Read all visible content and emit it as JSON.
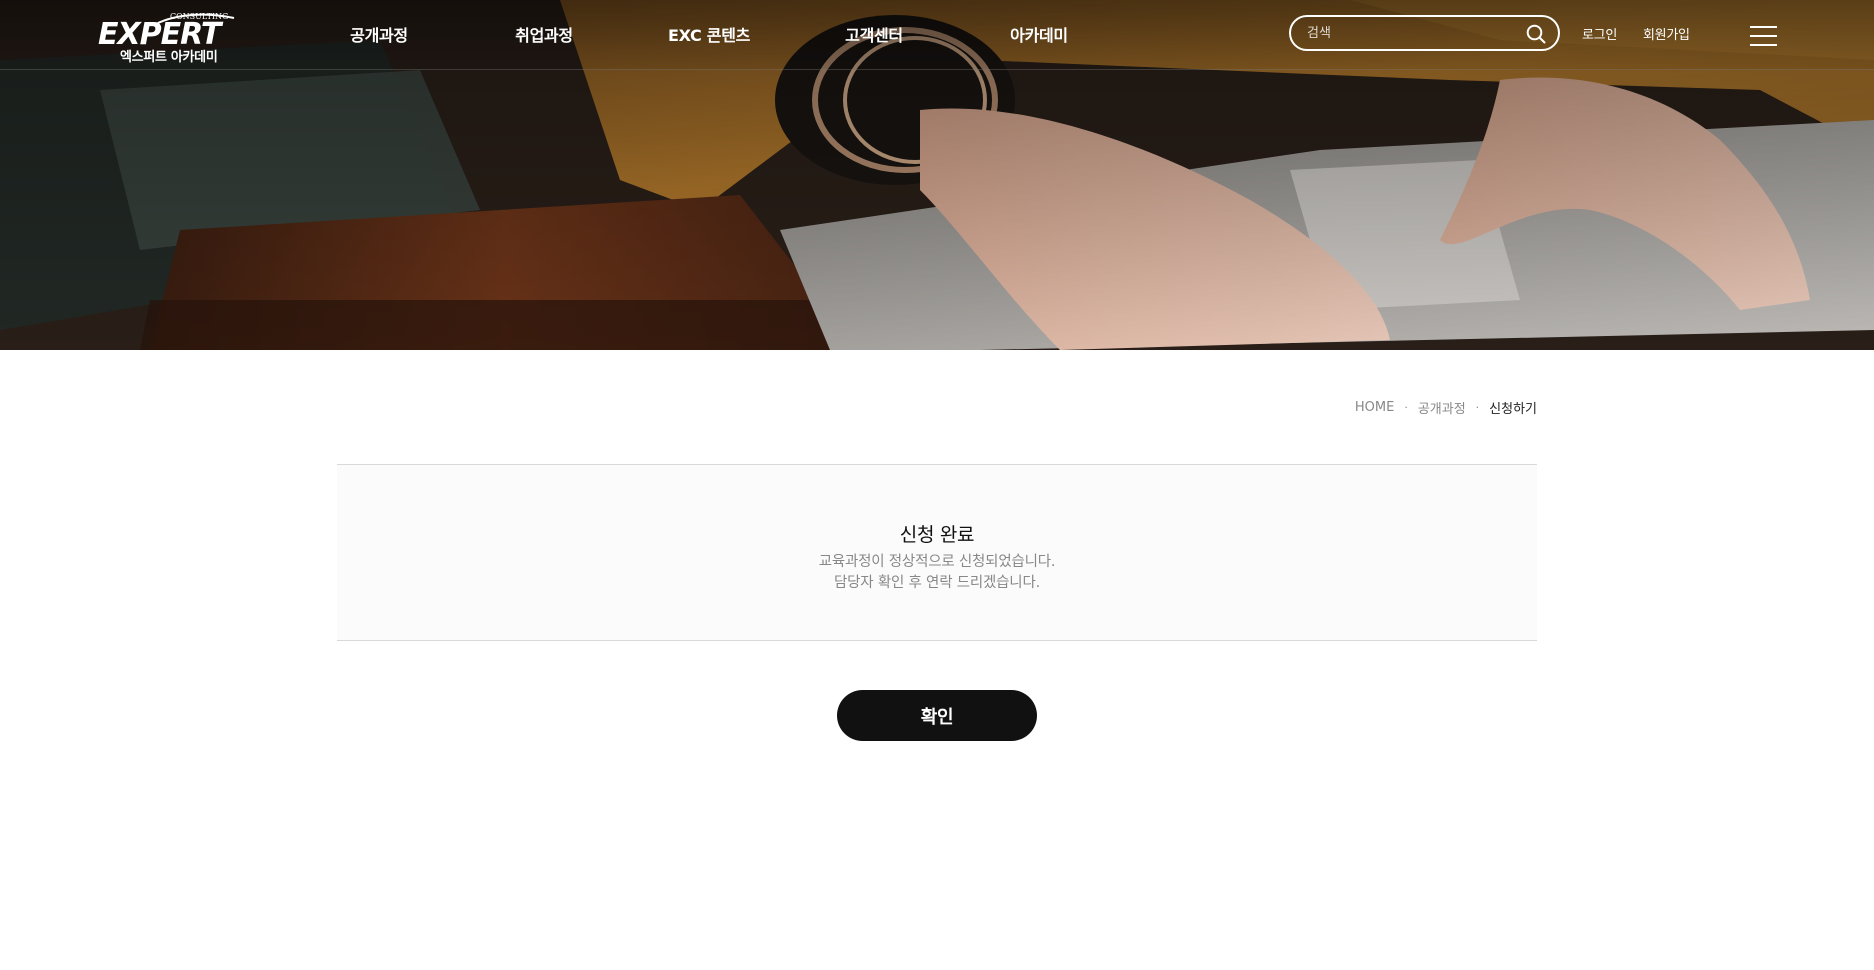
{
  "header": {
    "logo": {
      "wordmark": "EXPERT",
      "tagline": "CONSULTING",
      "subtitle": "엑스퍼트 아카데미"
    },
    "nav": [
      {
        "label": "공개과정"
      },
      {
        "label": "취업과정"
      },
      {
        "label": "EXC 콘텐츠"
      },
      {
        "label": "고객센터"
      },
      {
        "label": "아카데미"
      }
    ],
    "search": {
      "placeholder": "검색",
      "icon": "search-icon"
    },
    "login_label": "로그인",
    "signup_label": "회원가입",
    "menu_icon": "hamburger-menu-icon"
  },
  "breadcrumb": {
    "items": [
      "HOME",
      "공개과정",
      "신청하기"
    ]
  },
  "result": {
    "title": "신청 완료",
    "message_line1": "교육과정이 정상적으로 신청되었습니다.",
    "message_line2": "담당자 확인 후 연락 드리겠습니다."
  },
  "confirm_label": "확인",
  "colors": {
    "button_bg": "#111111",
    "result_bg": "#fbfbfb",
    "text_muted": "#888888"
  }
}
